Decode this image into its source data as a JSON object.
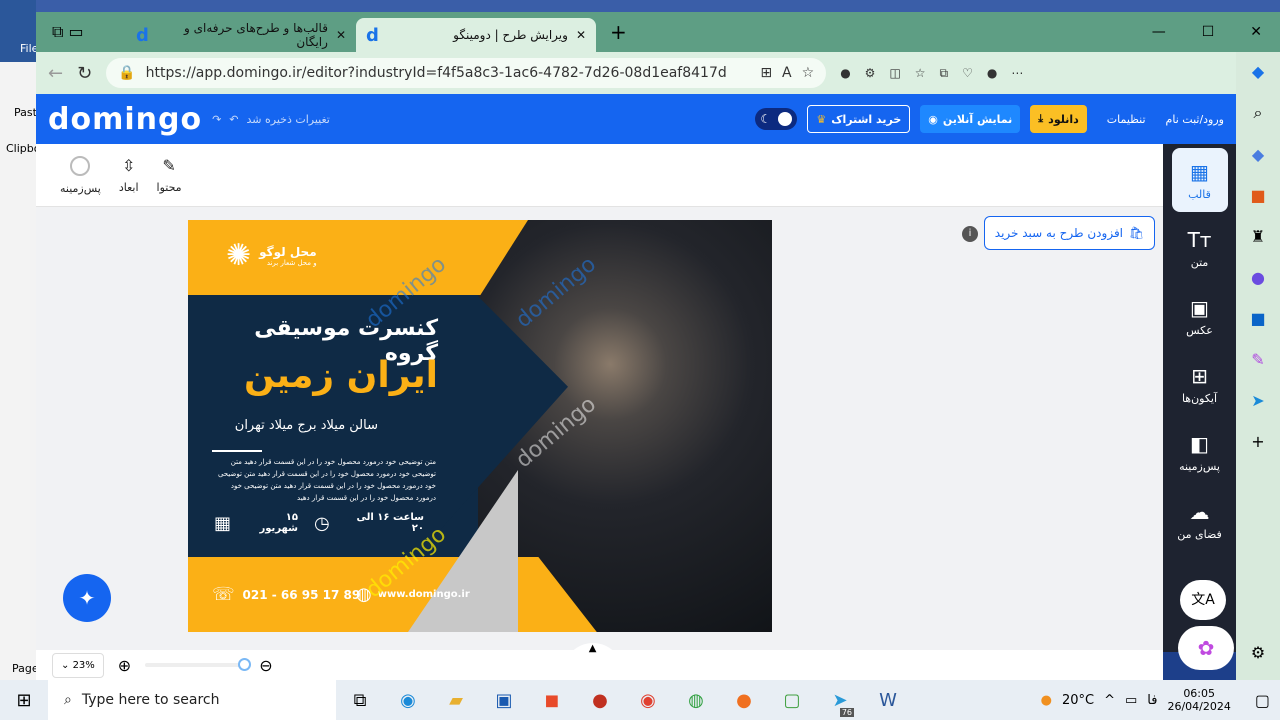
{
  "word": {
    "file": "File",
    "paste": "Paste",
    "clipboard": "Clipbo",
    "page": "Page"
  },
  "browser": {
    "tabs": [
      {
        "title": "قالب‌ها و طرح‌های حرفه‌ای و رایگان",
        "active": false
      },
      {
        "title": "ویرایش طرح | دومینگو",
        "active": true
      }
    ],
    "url": "https://app.domingo.ir/editor?industryId=f4f5a8c3-1ac6-4782-7d26-08d1eaf8417d"
  },
  "header": {
    "logo": "domingo",
    "save_status": "تغییرات ذخیره شد",
    "login": "ورود/ثبت نام",
    "settings": "تنظیمات",
    "download": "دانلود",
    "preview": "نمایش آنلاین",
    "subscribe": "خرید اشتراک",
    "accent": "#1565f0",
    "download_color": "#fbbf24"
  },
  "toolbar": {
    "items": [
      {
        "label": "پس‌زمینه",
        "icon": "circle-icon"
      },
      {
        "label": "ابعاد",
        "icon": "resize-icon"
      },
      {
        "label": "محتوا",
        "icon": "edit-icon"
      }
    ]
  },
  "add_to_cart": "افزودن طرح به سبد خرید",
  "sidebar": {
    "items": [
      {
        "label": "قالب",
        "icon": "layout-icon",
        "active": true
      },
      {
        "label": "متن",
        "icon": "text-icon"
      },
      {
        "label": "عکس",
        "icon": "image-icon"
      },
      {
        "label": "آیکون‌ها",
        "icon": "grid-icon"
      },
      {
        "label": "پس‌زمینه",
        "icon": "background-icon"
      },
      {
        "label": "فضای من",
        "icon": "cloud-upload-icon"
      }
    ]
  },
  "poster": {
    "logo_title": "محل لوگو",
    "logo_sub": "و محل شعار برند",
    "line1": "کنسرت موسیقی گروه",
    "line2": "ایران زمین",
    "venue": "سالن میلاد برج میلاد تهران",
    "body": "متن توضیحی خود درمورد محصول خود را در این قسمت قرار دهید متن توضیحی خود درمورد محصول خود را در این قسمت قرار دهید متن توضیحی خود درمورد محصول خود را در این قسمت قرار دهید متن توضیحی خود درمورد محصول خود را در این قسمت قرار دهید",
    "date": "۱۵ شهریور",
    "time": "ساعت ۱۶ الی ۲۰",
    "phone": "021 - 66 95 17 89",
    "website": "www.domingo.ir",
    "watermark": "domingo",
    "yellow": "#fbb016",
    "navy": "#0f2a45"
  },
  "zoom": {
    "level": "23%",
    "value": 23
  },
  "taskbar": {
    "search_placeholder": "Type here to search",
    "weather": "20°C",
    "lang": "فا",
    "time": "06:05",
    "date": "26/04/2024",
    "badge": "76"
  }
}
